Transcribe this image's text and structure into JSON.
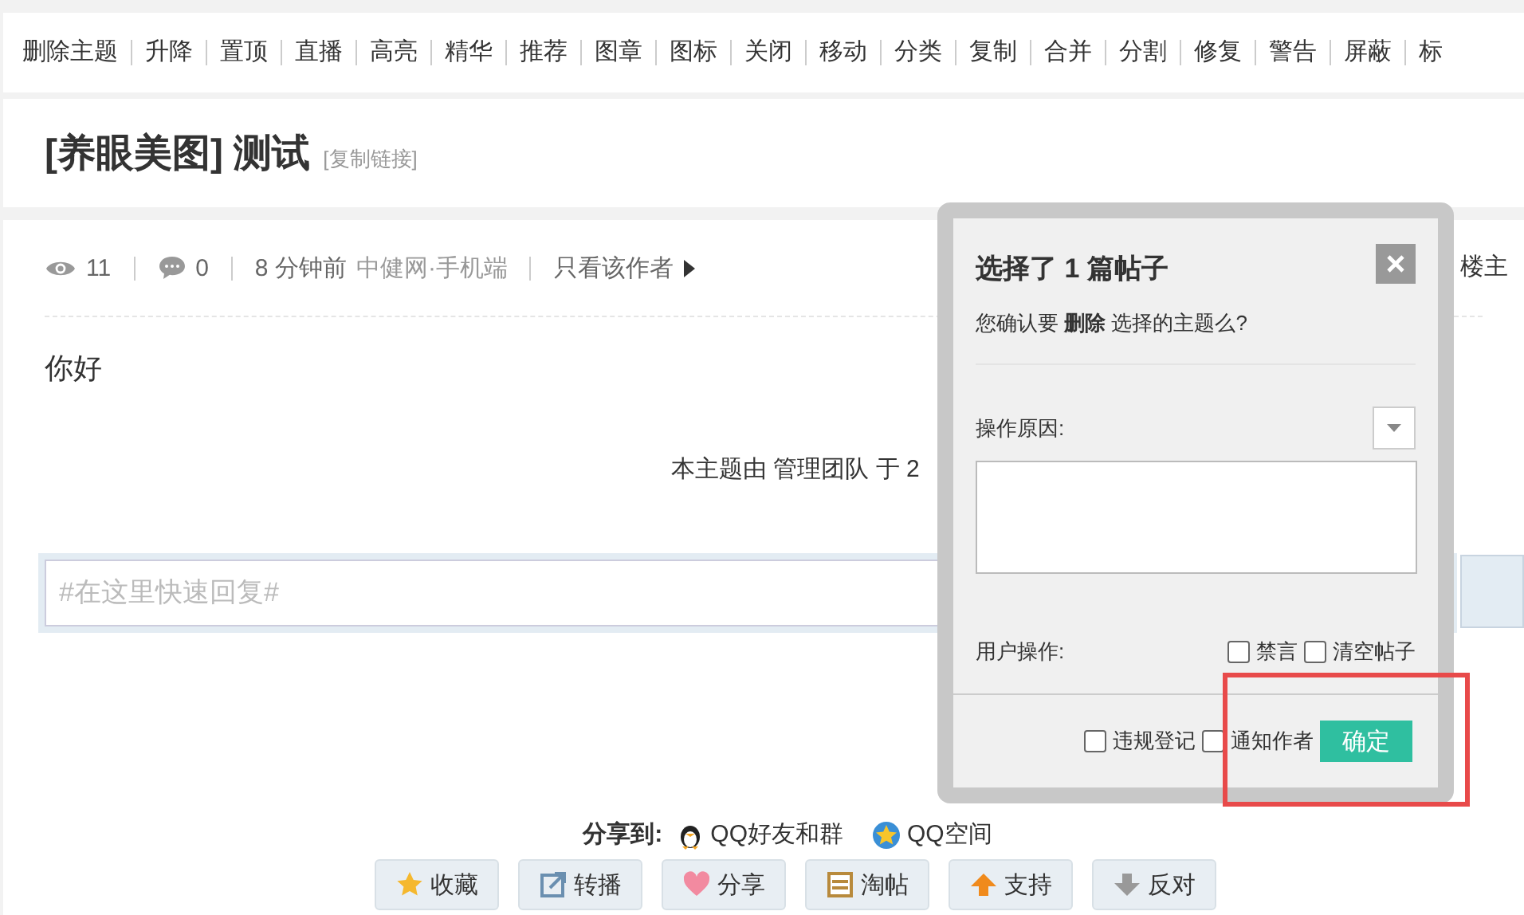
{
  "moderation_toolbar": {
    "actions": [
      "删除主题",
      "升降",
      "置顶",
      "直播",
      "高亮",
      "精华",
      "推荐",
      "图章",
      "图标",
      "关闭",
      "移动",
      "分类",
      "复制",
      "合并",
      "分割",
      "修复",
      "警告",
      "屏蔽",
      "标"
    ]
  },
  "thread": {
    "category": "[养眼美图]",
    "title": "测试",
    "copy_link": "[复制链接]"
  },
  "post_meta": {
    "views": "11",
    "replies": "0",
    "time": "8 分钟前",
    "source": "中健网·手机端",
    "author_filter": "只看该作者",
    "floor": "楼主"
  },
  "post_body": "你好",
  "moderation_note": "本主题由 管理团队 于 2",
  "quick_reply": {
    "placeholder": "#在这里快速回复#"
  },
  "share": {
    "label": "分享到:",
    "targets": [
      "QQ好友和群",
      "QQ空间"
    ]
  },
  "post_actions": [
    "收藏",
    "转播",
    "分享",
    "淘帖",
    "支持",
    "反对"
  ],
  "dialog": {
    "title": "选择了 1 篇帖子",
    "message": "您确认要 **删除** 选择的主题么?",
    "reason_label": "操作原因:",
    "user_ops_label": "用户操作:",
    "user_ops": [
      {
        "label": "禁言",
        "checked": false
      },
      {
        "label": "清空帖子",
        "checked": false
      }
    ],
    "footer_options": [
      {
        "label": "违规登记",
        "checked": false
      },
      {
        "label": "通知作者",
        "checked": false
      }
    ],
    "confirm": "确定"
  },
  "annotation": {
    "kind": "rectangle"
  }
}
